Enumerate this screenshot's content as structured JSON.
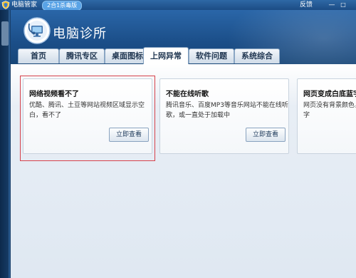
{
  "window": {
    "title": "电脑管家",
    "badge": "2合1杀毒版",
    "feedback": "反馈",
    "minimize_glyph": "—",
    "close_glyph": "□"
  },
  "header": {
    "app_title": "电脑诊所"
  },
  "tabs": [
    {
      "label": "首页",
      "active": false
    },
    {
      "label": "腾讯专区",
      "active": false
    },
    {
      "label": "桌面图标",
      "active": false
    },
    {
      "label": "上网异常",
      "active": true
    },
    {
      "label": "软件问题",
      "active": false
    },
    {
      "label": "系统综合",
      "active": false
    }
  ],
  "cards": [
    {
      "title": "网络视频看不了",
      "desc_line1": "优酷、腾讯、土豆等网站视频区域显示空",
      "desc_line2": "白，看不了",
      "button": "立即查看"
    },
    {
      "title": "不能在线听歌",
      "desc_line1": "腾讯音乐、百度MP3等音乐网站不能在线听",
      "desc_line2": "歌，或一直处于加载中",
      "button": "立即查看"
    },
    {
      "title": "网页变成白底蓝字",
      "desc_line1": "网页没有背景颜色，",
      "desc_line2": "字",
      "button": ""
    }
  ],
  "colors": {
    "highlight_border": "#d6414a",
    "header_blue": "#1b4e88",
    "badge_blue": "#59a3e6"
  }
}
